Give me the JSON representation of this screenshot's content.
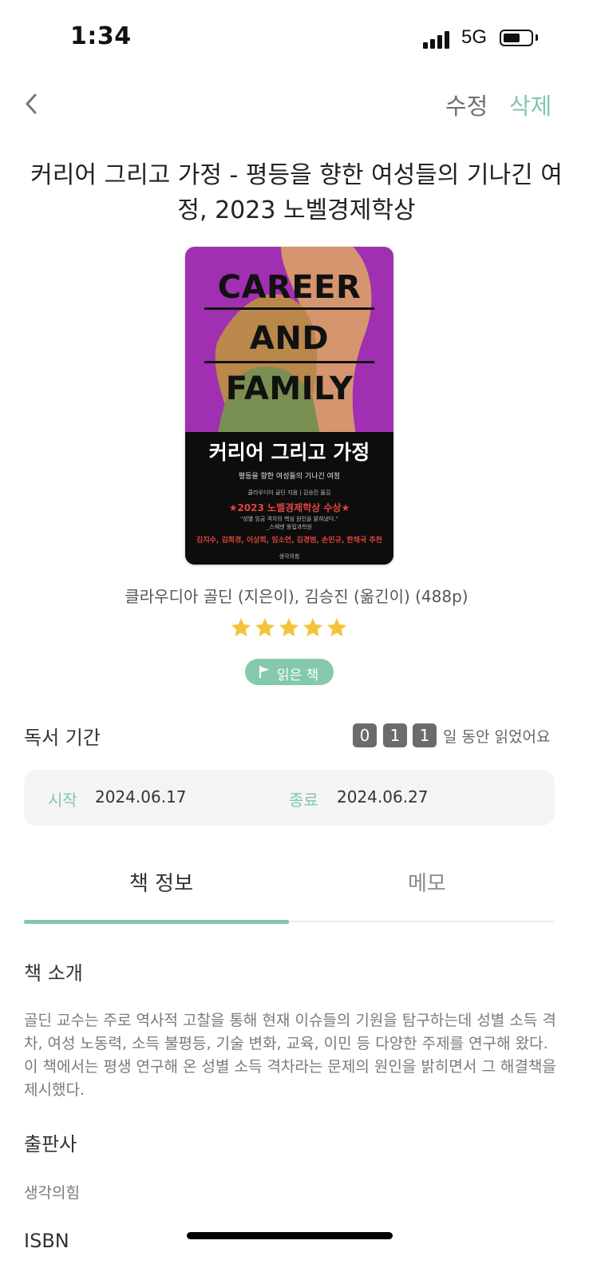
{
  "status_bar": {
    "time": "1:34",
    "network": "5G",
    "battery_level": 0.6
  },
  "nav": {
    "back_icon": "chevron-left-icon",
    "edit_label": "수정",
    "delete_label": "삭제"
  },
  "book": {
    "title": "커리어 그리고 가정 - 평등을 향한 여성들의 기나긴 여정, 2023 노벨경제학상",
    "authors": "클라우디아 골딘 (지은이), 김승진 (옮긴이) (488p)",
    "rating": 5,
    "rating_max": 5,
    "status": "읽은 책",
    "cover": {
      "line1": "CAREER",
      "line2": "AND",
      "line3": "FAMILY",
      "korean_title": "커리어 그리고 가정",
      "subtitle": "평등을 향한 여성들의 기나긴 여정",
      "credits": "클라우디아 골딘 지음 | 김승진 옮김",
      "award": "★2023 노벨경제학상 수상★",
      "quote": "\"성별 임금 격차의 핵심 원인을 밝혀냈다.\"",
      "quote_source": "_스웨덴 왕립과학원",
      "recommenders": "김지수, 김희경, 이상희, 임소연, 김경범, 손민규, 한채국 추천",
      "publisher_mark": "생각의힘"
    }
  },
  "reading_period": {
    "title": "독서 기간",
    "digits": [
      "0",
      "1",
      "1"
    ],
    "suffix": "일 동안 읽었어요",
    "start_label": "시작",
    "start_date": "2024.06.17",
    "end_label": "종료",
    "end_date": "2024.06.27"
  },
  "tabs": {
    "info": "책 정보",
    "memo": "메모",
    "active": "info"
  },
  "info": {
    "intro_heading": "책 소개",
    "intro_text": "골딘 교수는 주로 역사적 고찰을 통해 현재 이슈들의 기원을 탐구하는데 성별 소득 격차, 여성 노동력, 소득 불평등, 기술 변화, 교육, 이민 등 다양한 주제를 연구해 왔다. 이 책에서는 평생 연구해 온 성별 소득 격차라는 문제의 원인을 밝히면서 그 해결책을 제시했다.",
    "publisher_heading": "출판사",
    "publisher": "생각의힘",
    "isbn_heading": "ISBN"
  },
  "colors": {
    "accent": "#84c7aa",
    "cover_purple": "#a02fb1",
    "star": "#f5c33b"
  }
}
